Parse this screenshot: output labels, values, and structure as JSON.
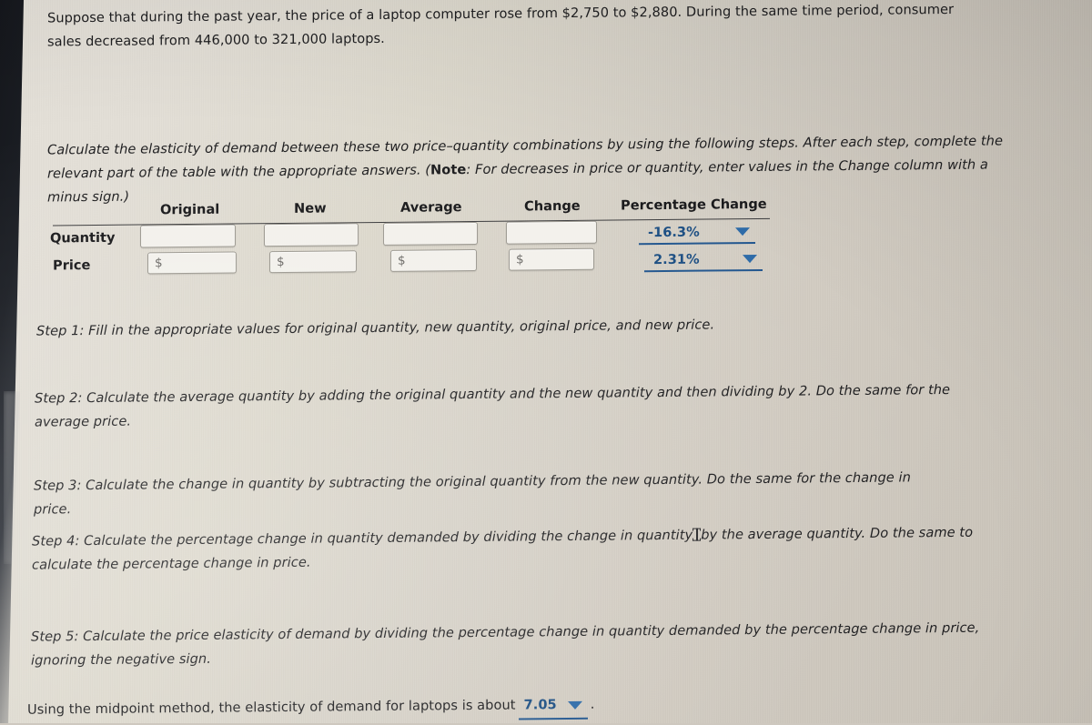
{
  "question": {
    "intro": "Suppose that during the past year, the price of a laptop computer rose from $2,750 to $2,880. During the same time period, consumer sales decreased from 446,000 to 321,000 laptops.",
    "instructions_part1": "Calculate the elasticity of demand between these two price–quantity combinations by using the following steps. After each step, complete the relevant part of the table with the appropriate answers. (",
    "instructions_note_label": "Note",
    "instructions_part2": ": For decreases in price or quantity, enter values in the Change column with a minus sign.)"
  },
  "table": {
    "headers": [
      "Original",
      "New",
      "Average",
      "Change",
      "Percentage Change"
    ],
    "rows": [
      {
        "label": "Quantity",
        "cells": [
          {
            "value": "",
            "placeholder": ""
          },
          {
            "value": "",
            "placeholder": ""
          },
          {
            "value": "",
            "placeholder": ""
          },
          {
            "value": "",
            "placeholder": ""
          }
        ],
        "percentage_change": "-16.3%"
      },
      {
        "label": "Price",
        "cells": [
          {
            "value": "",
            "placeholder": "$"
          },
          {
            "value": "",
            "placeholder": "$"
          },
          {
            "value": "",
            "placeholder": "$"
          },
          {
            "value": "",
            "placeholder": "$"
          }
        ],
        "percentage_change": "2.31%"
      }
    ]
  },
  "steps": {
    "step1": "Step 1: Fill in the appropriate values for original quantity, new quantity, original price, and new price.",
    "step2": "Step 2: Calculate the average quantity by adding the original quantity and the new quantity and then dividing by 2. Do the same for the average price.",
    "step3": "Step 3: Calculate the change in quantity by subtracting the original quantity from the new quantity. Do the same for the change in price.",
    "step4_a": "Step 4: Calculate the percentage change in quantity demanded by dividing the change in quantity",
    "step4_b": "by the average quantity. Do the same to calculate the percentage change in price.",
    "step5": "Step 5: Calculate the price elasticity of demand by dividing the percentage change in quantity demanded by the percentage change in price, ignoring the negative sign."
  },
  "conclusion": {
    "prefix": "Using the midpoint method, the elasticity of demand for laptops is about",
    "answer": "7.05",
    "suffix": "."
  },
  "colors": {
    "accent_blue": "#1d4f83",
    "caret_blue": "#2e6ba8",
    "text": "#1e1e20",
    "page_background": "#ded9d0",
    "input_background": "#f3f1ec",
    "input_border": "#9d9a92"
  }
}
